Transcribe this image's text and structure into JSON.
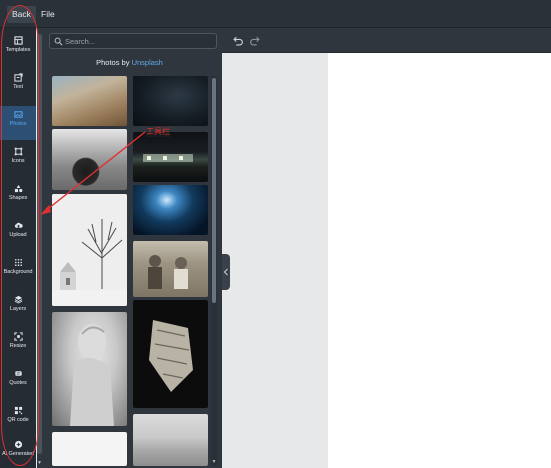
{
  "menubar": {
    "back": "Back",
    "file": "File"
  },
  "rail": {
    "items": [
      {
        "label": "Templates",
        "icon": "templates-icon"
      },
      {
        "label": "Text",
        "icon": "text-icon"
      },
      {
        "label": "Photos",
        "icon": "photos-icon",
        "active": true
      },
      {
        "label": "Icons",
        "icon": "icons-icon"
      },
      {
        "label": "Shapes",
        "icon": "shapes-icon"
      },
      {
        "label": "Upload",
        "icon": "upload-icon"
      },
      {
        "label": "Background",
        "icon": "background-icon"
      },
      {
        "label": "Layers",
        "icon": "layers-icon"
      },
      {
        "label": "Resize",
        "icon": "resize-icon"
      },
      {
        "label": "Quotes",
        "icon": "quotes-icon"
      },
      {
        "label": "QR code",
        "icon": "qr-code-icon"
      },
      {
        "label": "AI Generated",
        "icon": "ai-generated-icon"
      }
    ]
  },
  "panel": {
    "search_placeholder": "Search...",
    "title_prefix": "Photos by ",
    "title_link": "Unsplash",
    "photos": [
      {
        "name": "dry-hillside"
      },
      {
        "name": "dark-night-sky"
      },
      {
        "name": "bear-in-forest"
      },
      {
        "name": "building-at-night"
      },
      {
        "name": "snowy-tree-chapel"
      },
      {
        "name": "underwater-cave-light"
      },
      {
        "name": "vintage-sepia-group"
      },
      {
        "name": "marble-statue"
      },
      {
        "name": "seashell-on-black"
      },
      {
        "name": "white-photo"
      },
      {
        "name": "misty-shore"
      }
    ]
  },
  "annotation": {
    "label": "工具栏"
  },
  "colors": {
    "accent": "#56a8f0",
    "annotation": "#e03030"
  }
}
